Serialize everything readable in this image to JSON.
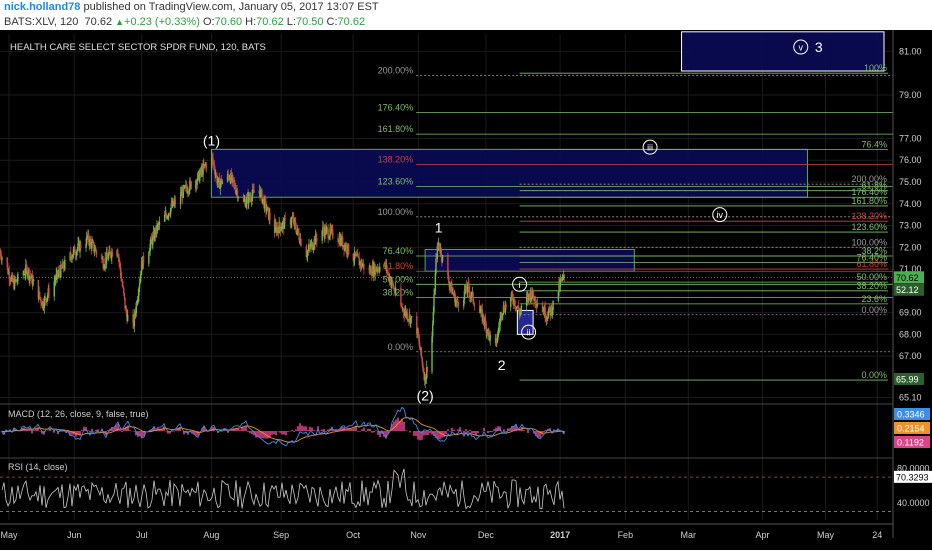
{
  "header": {
    "user": "nick.holland78",
    "published": "published on TradingView.com, January 05, 2017 13:07 EST",
    "symbol": "BATS:XLV, 120",
    "last": "70.62",
    "change": "+0.23 (+0.33%)",
    "o_label": "O:",
    "o": "70.60",
    "h_label": "H:",
    "h": "70.62",
    "l_label": "L:",
    "l": "70.50",
    "c_label": "C:",
    "c": "70.62"
  },
  "colors": {
    "background": "#000000",
    "grid": "#1a1a1a",
    "text": "#cfcfcf",
    "fib_green": "#7fbf6a",
    "fib_red": "#d0403f",
    "fib_gray": "#9a9a9a",
    "zone_fill": "#0a0a55",
    "candle_up": "#6fbf3f",
    "candle_down": "#d0493f",
    "macd_line": "#3d8fe0",
    "signal_line": "#f0902a",
    "hist": "#e0418b",
    "rsi": "#cccccc",
    "rsi_band": "#c84a4a"
  },
  "chart_data": {
    "type": "candlestick",
    "title": "HEALTH CARE SELECT SECTOR SPDR FUND, 120, BATS",
    "x_range": [
      "2016-04-29",
      "2017-05-31"
    ],
    "y_range": [
      64.8,
      81.8
    ],
    "y_ticks": [
      "81.00",
      "79.00",
      "77.00",
      "76.00",
      "75.00",
      "74.00",
      "73.00",
      "72.00",
      "71.00",
      "69.00",
      "68.00",
      "67.00",
      "65.10"
    ],
    "x_labels": [
      {
        "label": "May",
        "date": "2016-05-03"
      },
      {
        "label": "Jun",
        "date": "2016-06-01"
      },
      {
        "label": "Jul",
        "date": "2016-07-01"
      },
      {
        "label": "Aug",
        "date": "2016-08-01"
      },
      {
        "label": "Sep",
        "date": "2016-09-01"
      },
      {
        "label": "Oct",
        "date": "2016-10-03"
      },
      {
        "label": "Nov",
        "date": "2016-11-01"
      },
      {
        "label": "Dec",
        "date": "2016-12-01"
      },
      {
        "label": "2017",
        "date": "2017-01-03"
      },
      {
        "label": "Feb",
        "date": "2017-02-01"
      },
      {
        "label": "Mar",
        "date": "2017-03-01"
      },
      {
        "label": "Apr",
        "date": "2017-04-03"
      },
      {
        "label": "May",
        "date": "2017-05-01"
      },
      {
        "label": "24",
        "date": "2017-05-24"
      }
    ],
    "price_path": [
      [
        "2016-04-29",
        71.8
      ],
      [
        "2016-05-05",
        70.3
      ],
      [
        "2016-05-11",
        71.0
      ],
      [
        "2016-05-18",
        69.4
      ],
      [
        "2016-05-24",
        70.6
      ],
      [
        "2016-05-31",
        71.7
      ],
      [
        "2016-06-07",
        72.4
      ],
      [
        "2016-06-14",
        71.3
      ],
      [
        "2016-06-20",
        72.1
      ],
      [
        "2016-06-24",
        69.0
      ],
      [
        "2016-06-27",
        68.2
      ],
      [
        "2016-07-01",
        71.2
      ],
      [
        "2016-07-08",
        72.9
      ],
      [
        "2016-07-14",
        73.8
      ],
      [
        "2016-07-20",
        74.6
      ],
      [
        "2016-07-26",
        75.2
      ],
      [
        "2016-08-01",
        76.2
      ],
      [
        "2016-08-04",
        74.9
      ],
      [
        "2016-08-09",
        75.3
      ],
      [
        "2016-08-15",
        74.0
      ],
      [
        "2016-08-22",
        74.7
      ],
      [
        "2016-08-29",
        72.8
      ],
      [
        "2016-09-06",
        73.3
      ],
      [
        "2016-09-12",
        71.7
      ],
      [
        "2016-09-19",
        72.8
      ],
      [
        "2016-09-26",
        72.5
      ],
      [
        "2016-10-03",
        71.6
      ],
      [
        "2016-10-10",
        70.9
      ],
      [
        "2016-10-17",
        71.2
      ],
      [
        "2016-10-24",
        69.3
      ],
      [
        "2016-10-31",
        68.4
      ],
      [
        "2016-11-04",
        65.9
      ],
      [
        "2016-11-07",
        67.8
      ],
      [
        "2016-11-09",
        71.6
      ],
      [
        "2016-11-10",
        72.2
      ],
      [
        "2016-11-14",
        70.6
      ],
      [
        "2016-11-18",
        69.4
      ],
      [
        "2016-11-23",
        70.1
      ],
      [
        "2016-11-30",
        68.7
      ],
      [
        "2016-12-05",
        67.2
      ],
      [
        "2016-12-08",
        69.1
      ],
      [
        "2016-12-13",
        69.7
      ],
      [
        "2016-12-16",
        69.0
      ],
      [
        "2016-12-21",
        69.9
      ],
      [
        "2016-12-28",
        68.9
      ],
      [
        "2016-12-30",
        69.1
      ],
      [
        "2017-01-03",
        70.3
      ],
      [
        "2017-01-05",
        70.62
      ]
    ],
    "last_price": "70.62",
    "price_labels": [
      "70.62",
      "52.12",
      "65.99"
    ],
    "wave_labels": [
      {
        "text": "(1)",
        "date": "2016-08-01",
        "price": 76.9
      },
      {
        "text": "(2)",
        "date": "2016-11-04",
        "price": 65.2
      },
      {
        "text": "1",
        "date": "2016-11-10",
        "price": 72.9
      },
      {
        "text": "2",
        "date": "2016-12-08",
        "price": 66.6
      },
      {
        "text": "i",
        "date": "2016-12-16",
        "price": 70.3,
        "circled": true
      },
      {
        "text": "ii",
        "date": "2016-12-20",
        "price": 68.1,
        "circled": true
      },
      {
        "text": "iii",
        "date": "2017-02-12",
        "price": 76.6,
        "circled": true
      },
      {
        "text": "iv",
        "date": "2017-03-15",
        "price": 73.5,
        "circled": true
      },
      {
        "text": "v",
        "date": "2017-04-20",
        "price": 81.2,
        "circled": true
      },
      {
        "text": "3",
        "date": "2017-04-28",
        "price": 81.2
      }
    ],
    "fib_set_a": [
      {
        "label": "200.00%",
        "price": 79.9,
        "color": "gray",
        "end": "2017-05-31"
      },
      {
        "label": "176.40%",
        "price": 78.2,
        "color": "green",
        "end": "2017-05-31"
      },
      {
        "label": "161.80%",
        "price": 77.2,
        "color": "green",
        "end": "2017-05-31"
      },
      {
        "label": "138.20%",
        "price": 75.8,
        "color": "red",
        "end": "2017-05-31"
      },
      {
        "label": "123.60%",
        "price": 74.8,
        "color": "green",
        "end": "2017-05-31"
      },
      {
        "label": "100.00%",
        "price": 73.4,
        "color": "gray",
        "end": "2017-05-31"
      },
      {
        "label": "76.40%",
        "price": 71.6,
        "color": "green",
        "end": "2017-05-31"
      },
      {
        "label": "61.80%",
        "price": 70.9,
        "color": "red",
        "end": "2017-05-31"
      },
      {
        "label": "50.00%",
        "price": 70.3,
        "color": "green",
        "end": "2017-05-31"
      },
      {
        "label": "38.20%",
        "price": 69.7,
        "color": "green",
        "end": "2017-05-31"
      },
      {
        "label": "0.00%",
        "price": 67.2,
        "color": "gray",
        "end": "2017-05-31"
      }
    ],
    "fib_set_b": [
      {
        "label": "100%",
        "price": 80.0,
        "color": "green"
      },
      {
        "label": "76.4%",
        "price": 76.5,
        "color": "green"
      },
      {
        "label": "200.00%",
        "price": 74.9,
        "color": "gray"
      },
      {
        "label": "61.8%",
        "price": 74.6,
        "color": "green"
      },
      {
        "label": "176.40%",
        "price": 74.3,
        "color": "green"
      },
      {
        "label": "161.80%",
        "price": 73.9,
        "color": "green"
      },
      {
        "label": "138.20%",
        "price": 73.2,
        "color": "red"
      },
      {
        "label": "123.60%",
        "price": 72.7,
        "color": "green"
      },
      {
        "label": "100.00%",
        "price": 72.0,
        "color": "gray"
      },
      {
        "label": "38.2%",
        "price": 71.6,
        "color": "green"
      },
      {
        "label": "76.40%",
        "price": 71.3,
        "color": "green"
      },
      {
        "label": "61.80%",
        "price": 71.0,
        "color": "red"
      },
      {
        "label": "50.00%",
        "price": 70.4,
        "color": "green"
      },
      {
        "label": "38.20%",
        "price": 70.0,
        "color": "green"
      },
      {
        "label": "23.6%",
        "price": 69.4,
        "color": "green"
      },
      {
        "label": "0.00%",
        "price": 68.9,
        "color": "gray"
      },
      {
        "label": "0.00%",
        "price": 65.9,
        "color": "green"
      }
    ],
    "zones": [
      {
        "from": "2016-08-01",
        "to": "2017-04-23",
        "top": 76.5,
        "bottom": 74.3,
        "color": "#0a0a55",
        "border": "#4caf50"
      },
      {
        "from": "2016-11-04",
        "to": "2017-02-05",
        "top": 71.9,
        "bottom": 70.9,
        "color": "#0a0a55",
        "border": "#4caf50"
      },
      {
        "from": "2016-12-15",
        "to": "2016-12-22",
        "top": 69.1,
        "bottom": 68.0,
        "color": "#2a2aa0",
        "border": "#ffffff"
      },
      {
        "from": "2017-02-26",
        "to": "2017-05-27",
        "top": 81.9,
        "bottom": 80.1,
        "color": "#0a0a55",
        "border": "#ffffff"
      }
    ],
    "macd": {
      "title": "MACD (12, 26, close, 9, false, true)",
      "labels": [
        "0.3346",
        "0.2154",
        "0.1192"
      ],
      "label_colors": [
        "#3d8fe0",
        "#f0902a",
        "#e0418b"
      ],
      "range": [
        -1.2,
        1.2
      ]
    },
    "rsi": {
      "title": "RSI (14, close)",
      "ticks": [
        "80.0000",
        "40.0000"
      ],
      "value": "70.3293",
      "range": [
        20,
        90
      ],
      "upper": 70,
      "lower": 30
    }
  }
}
